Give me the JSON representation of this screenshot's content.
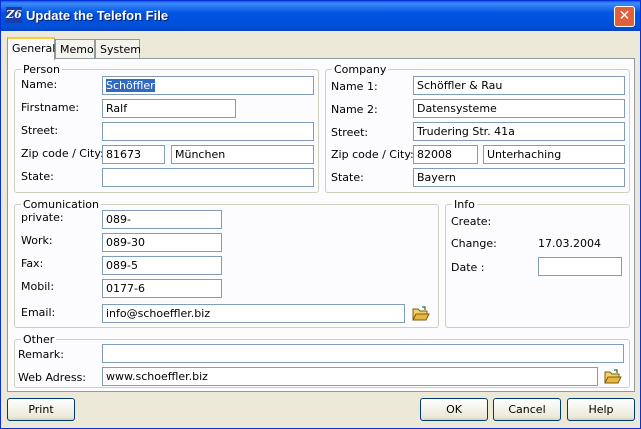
{
  "window": {
    "title": "Update the Telefon File",
    "icon_glyph": "Z6",
    "close_glyph": "✕"
  },
  "tabs": [
    {
      "label": "General",
      "active": true
    },
    {
      "label": "Memo",
      "active": false
    },
    {
      "label": "System",
      "active": false
    }
  ],
  "person": {
    "legend": "Person",
    "name_label": "Name:",
    "name_value": "Schöffler",
    "firstname_label": "Firstname:",
    "firstname_value": "Ralf",
    "street_label": "Street:",
    "street_value": "",
    "zip_label": "Zip code / City:",
    "zip_value": "81673",
    "city_value": "München",
    "state_label": "State:",
    "state_value": ""
  },
  "company": {
    "legend": "Company",
    "name1_label": "Name 1:",
    "name1_value": "Schöffler & Rau",
    "name2_label": "Name 2:",
    "name2_value": "Datensysteme",
    "street_label": "Street:",
    "street_value": "Trudering Str. 41a",
    "zip_label": "Zip code / City:",
    "zip_value": "82008",
    "city_value": "Unterhaching",
    "state_label": "State:",
    "state_value": "Bayern"
  },
  "communication": {
    "legend": "Comunication",
    "private_label": "private:",
    "private_value": "089-",
    "work_label": "Work:",
    "work_value": "089-30",
    "fax_label": "Fax:",
    "fax_value": "089-5",
    "mobil_label": "Mobil:",
    "mobil_value": "0177-6",
    "email_label": "Email:",
    "email_value": "info@schoeffler.biz",
    "email_browse_icon": "folder-open-icon"
  },
  "info": {
    "legend": "Info",
    "create_label": "Create:",
    "create_value": "",
    "change_label": "Change:",
    "change_value": "17.03.2004",
    "date_label": "Date :",
    "date_value": ""
  },
  "other": {
    "legend": "Other",
    "remark_label": "Remark:",
    "remark_value": "",
    "web_label": "Web Adress:",
    "web_value": "www.schoeffler.biz",
    "web_browse_icon": "folder-open-icon"
  },
  "buttons": {
    "print": "Print",
    "ok": "OK",
    "cancel": "Cancel",
    "help": "Help"
  },
  "colors": {
    "titlebar": "#0054e3",
    "selection": "#316ac5",
    "dialog_bg": "#ece9d8"
  }
}
